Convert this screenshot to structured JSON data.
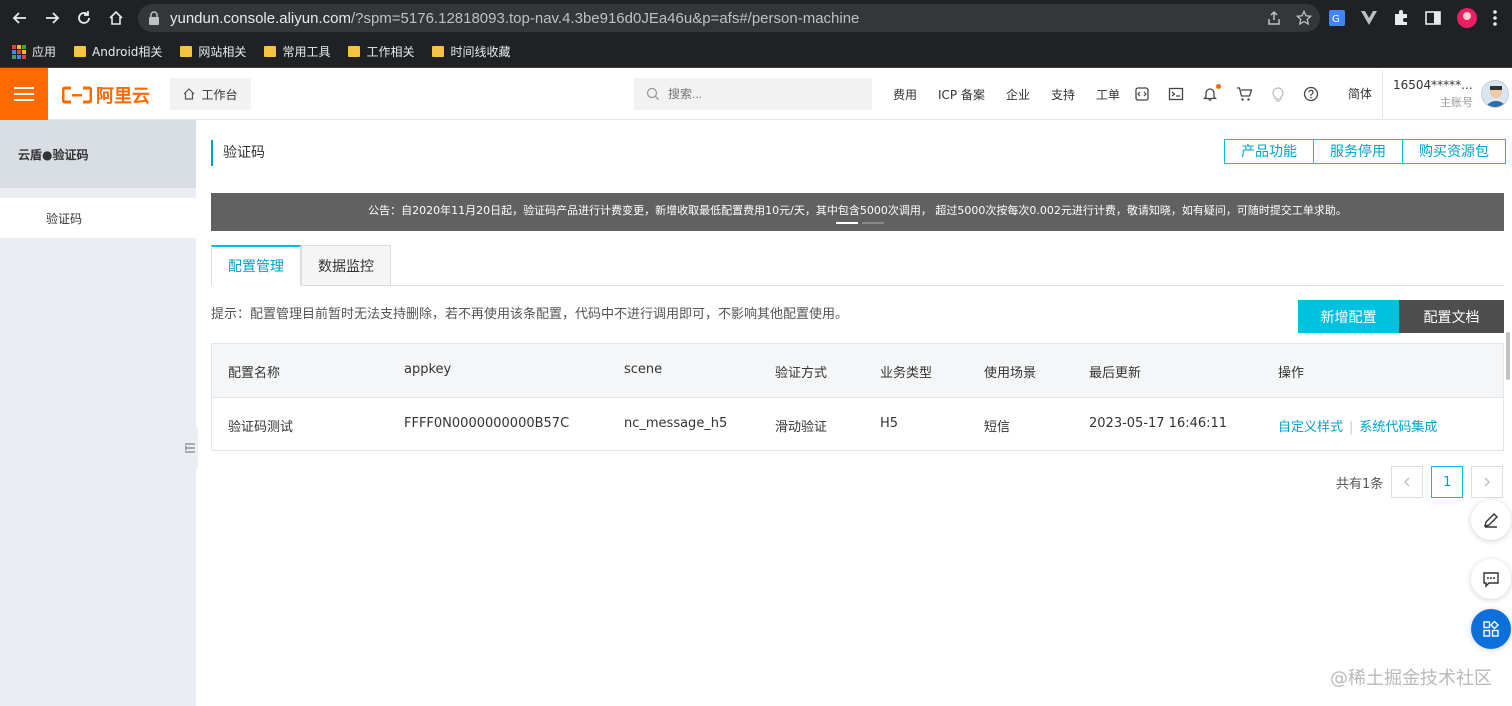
{
  "browser": {
    "url_host": "yundun.console.aliyun.com",
    "url_path": "/?spm=5176.12818093.top-nav.4.3be916d0JEa46u&p=afs#/person-machine",
    "bookmarks": [
      "应用",
      "Android相关",
      "网站相关",
      "常用工具",
      "工作相关",
      "时间线收藏"
    ]
  },
  "header": {
    "logo_text": "阿里云",
    "workbench_label": "工作台",
    "search_placeholder": "搜索...",
    "links": [
      "费用",
      "ICP 备案",
      "企业",
      "支持",
      "工单"
    ],
    "language": "简体",
    "account_name": "16504*****...",
    "account_role": "主账号",
    "brand_color": "#ff6a00"
  },
  "sidebar": {
    "title": "云盾●验证码",
    "items": [
      {
        "label": "验证码"
      }
    ]
  },
  "main": {
    "page_title": "验证码",
    "top_actions": [
      "产品功能",
      "服务停用",
      "购买资源包"
    ],
    "announcement": "公告：自2020年11月20日起，验证码产品进行计费变更，新增收取最低配置费用10元/天，其中包含5000次调用， 超过5000次按每次0.002元进行计费，敬请知晓，如有疑问，可随时提交工单求助。",
    "tabs": [
      {
        "label": "配置管理",
        "active": true
      },
      {
        "label": "数据监控",
        "active": false
      }
    ],
    "hint": "提示：配置管理目前暂时无法支持删除，若不再使用该条配置，代码中不进行调用即可，不影响其他配置使用。",
    "add_button": "新增配置",
    "doc_button": "配置文档",
    "table": {
      "columns": [
        "配置名称",
        "appkey",
        "scene",
        "验证方式",
        "业务类型",
        "使用场景",
        "最后更新",
        "操作"
      ],
      "rows": [
        {
          "name": "验证码测试",
          "appkey": "FFFF0N0000000000B57C",
          "scene": "nc_message_h5",
          "method": "滑动验证",
          "biz_type": "H5",
          "usage": "短信",
          "updated": "2023-05-17 16:46:11",
          "actions": [
            "自定义样式",
            "系统代码集成"
          ]
        }
      ]
    },
    "pagination": {
      "total_text": "共有1条",
      "current_page": "1"
    },
    "accent_color": "#00c1de"
  },
  "watermark": "@稀土掘金技术社区"
}
